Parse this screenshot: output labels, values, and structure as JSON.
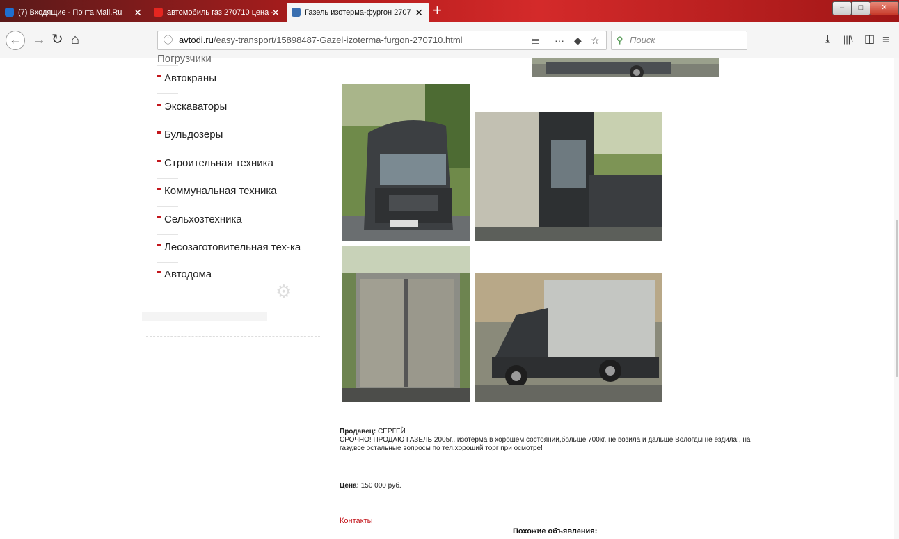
{
  "browser": {
    "tabs": [
      {
        "title": "(7) Входящие - Почта Mail.Ru",
        "icon": "mail-ru-icon",
        "icon_color": "#1f6fd0"
      },
      {
        "title": "автомобиль газ 270710 цена -",
        "icon": "yandex-icon",
        "icon_color": "#e52620"
      },
      {
        "title": "Газель изотерма-фургон 2707",
        "icon": "avtodi-icon",
        "icon_color": "#3a6fb0"
      }
    ],
    "new_tab_glyph": "+",
    "close_glyph": "✕",
    "url_host": "avtodi.ru",
    "url_path": "/easy-transport/15898487-Gazel-izoterma-furgon-270710.html",
    "search_placeholder": "Поиск",
    "glyphs": {
      "back": "←",
      "forward": "→",
      "reload": "↻",
      "home": "⌂",
      "info": "ⓘ",
      "reader": "▤",
      "more": "···",
      "pocket": "◆",
      "bookmark": "☆",
      "search": "⚲",
      "download": "⤓",
      "library": "|||\\",
      "sidebar": "◫",
      "menu": "≡",
      "minimize": "–",
      "maximize": "□",
      "close_window": "✕"
    }
  },
  "sidebar": {
    "partial_top_label": "Погрузчики",
    "items": [
      "Автокраны",
      "Экскаваторы",
      "Бульдозеры",
      "Строительная техника",
      "Коммунальная техника",
      "Сельхозтехника",
      "Лесозаготовительная тех-ка",
      "Автодома"
    ],
    "gear_glyph": "⚙"
  },
  "listing": {
    "seller_label": "Продавец:",
    "seller_name": "СЕРГЕЙ",
    "description": "СРОЧНО! ПРОДАЮ ГАЗЕЛЬ 2005г., изотерма в хорошем состоянии,больше 700кг. не возила и дальше Вологды не ездила!, на газу,все остальные вопросы по тел.хороший торг при осмотре!",
    "price_label": "Цена:",
    "price_value": "150 000 руб.",
    "contacts_link": "Контакты",
    "similar_heading": "Похожие объявления:"
  },
  "colors": {
    "accent_red": "#c3161c",
    "tabbar_red": "#c62020"
  }
}
